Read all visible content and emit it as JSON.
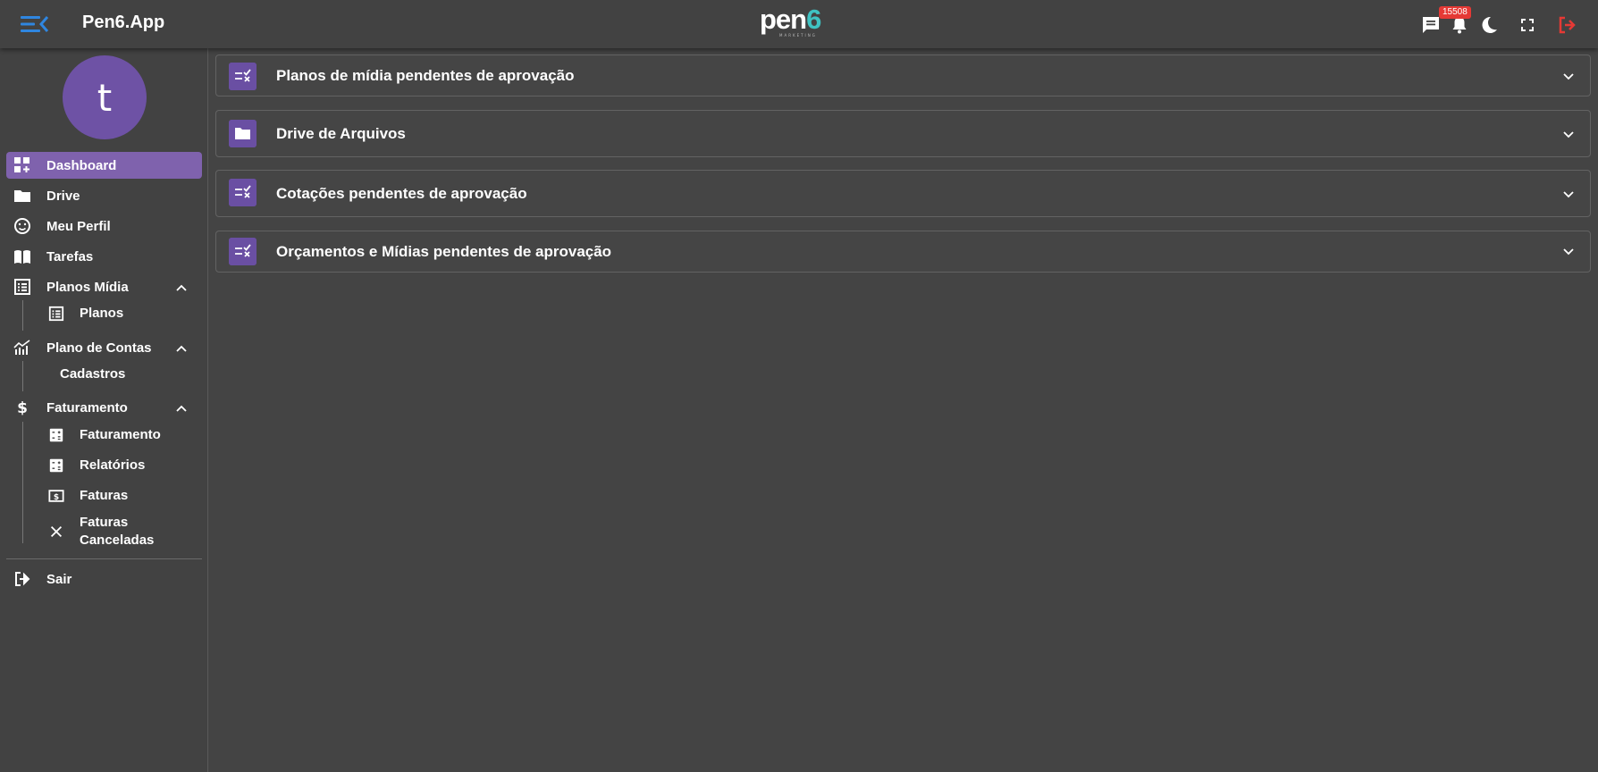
{
  "header": {
    "app_title": "Pen6.App",
    "logo_text_main": "pen",
    "logo_text_accent": "6",
    "logo_subtext": "MARKETING",
    "notification_count": "15508",
    "icons": [
      "menu-collapse-icon",
      "chat-icon",
      "bell-icon",
      "theme-moon-icon",
      "fullscreen-icon",
      "logout-icon"
    ],
    "accent_color": "#2f86e0",
    "logout_color": "#e53935"
  },
  "sidebar": {
    "avatar_letter": "t",
    "avatar_color": "#6e52a5",
    "active_color": "#7f62ad",
    "items": {
      "dashboard": "Dashboard",
      "drive": "Drive",
      "meu_perfil": "Meu Perfil",
      "tarefas": "Tarefas",
      "planos_midia": "Planos Mídia",
      "planos": "Planos",
      "plano_de_contas": "Plano de Contas",
      "cadastros": "Cadastros",
      "faturamento_group": "Faturamento",
      "faturamento": "Faturamento",
      "relatorios": "Relatórios",
      "faturas": "Faturas",
      "faturas_canceladas_1": "Faturas",
      "faturas_canceladas_2": "Canceladas",
      "sair": "Sair"
    }
  },
  "main": {
    "panels": [
      {
        "label": "Planos de mídia pendentes de aprovação",
        "icon": "approval-list-icon"
      },
      {
        "label": "Drive de Arquivos",
        "icon": "folder-icon"
      },
      {
        "label": "Cotações pendentes de aprovação",
        "icon": "approval-list-icon"
      },
      {
        "label": "Orçamentos e Mídias pendentes de aprovação",
        "icon": "approval-list-icon"
      }
    ],
    "panel_icon_color": "#6a4fa3"
  }
}
